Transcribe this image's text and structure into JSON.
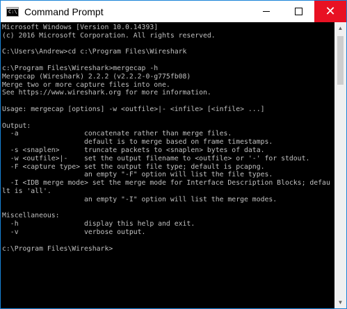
{
  "window": {
    "title": "Command Prompt",
    "icon_name": "console-icon",
    "icon_text": "C:\\",
    "close_glyph": "✕"
  },
  "console": {
    "lines": [
      "Microsoft Windows [Version 10.0.14393]",
      "(c) 2016 Microsoft Corporation. All rights reserved.",
      "",
      "C:\\Users\\Andrew>cd c:\\Program Files\\Wireshark",
      "",
      "c:\\Program Files\\Wireshark>mergecap -h",
      "Mergecap (Wireshark) 2.2.2 (v2.2.2-0-g775fb08)",
      "Merge two or more capture files into one.",
      "See https://www.wireshark.org for more information.",
      "",
      "Usage: mergecap [options] -w <outfile>|- <infile> [<infile> ...]",
      "",
      "Output:",
      "  -a                concatenate rather than merge files.",
      "                    default is to merge based on frame timestamps.",
      "  -s <snaplen>      truncate packets to <snaplen> bytes of data.",
      "  -w <outfile>|-    set the output filename to <outfile> or '-' for stdout.",
      "  -F <capture type> set the output file type; default is pcapng.",
      "                    an empty \"-F\" option will list the file types.",
      "  -I <IDB merge mode> set the merge mode for Interface Description Blocks; defau",
      "lt is 'all'.",
      "                    an empty \"-I\" option will list the merge modes.",
      "",
      "Miscellaneous:",
      "  -h                display this help and exit.",
      "  -v                verbose output.",
      "",
      "c:\\Program Files\\Wireshark>"
    ]
  },
  "colors": {
    "console_bg": "#000000",
    "console_fg": "#c0c0c0",
    "close_hover": "#e81123",
    "border": "#1883d7"
  }
}
